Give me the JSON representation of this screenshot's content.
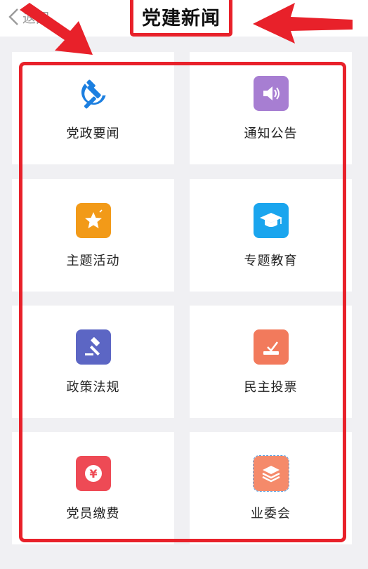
{
  "header": {
    "back_label": "返回",
    "title": "党建新闻"
  },
  "grid": {
    "items": [
      {
        "label": "党政要闻",
        "icon": "hammer-sickle-icon",
        "color": "#1c7fe0"
      },
      {
        "label": "通知公告",
        "icon": "speaker-icon",
        "color": "#a77ed2"
      },
      {
        "label": "主题活动",
        "icon": "star-icon",
        "color": "#f29a18"
      },
      {
        "label": "专题教育",
        "icon": "graduation-cap-icon",
        "color": "#1aa5ee"
      },
      {
        "label": "政策法规",
        "icon": "gavel-icon",
        "color": "#5c66c4"
      },
      {
        "label": "民主投票",
        "icon": "ballot-box-icon",
        "color": "#f27a5c"
      },
      {
        "label": "党员缴费",
        "icon": "yen-coin-icon",
        "color": "#ee4a55"
      },
      {
        "label": "业委会",
        "icon": "layers-icon",
        "color": "#f58a6a"
      }
    ]
  },
  "annotation_color": "#e8212a"
}
